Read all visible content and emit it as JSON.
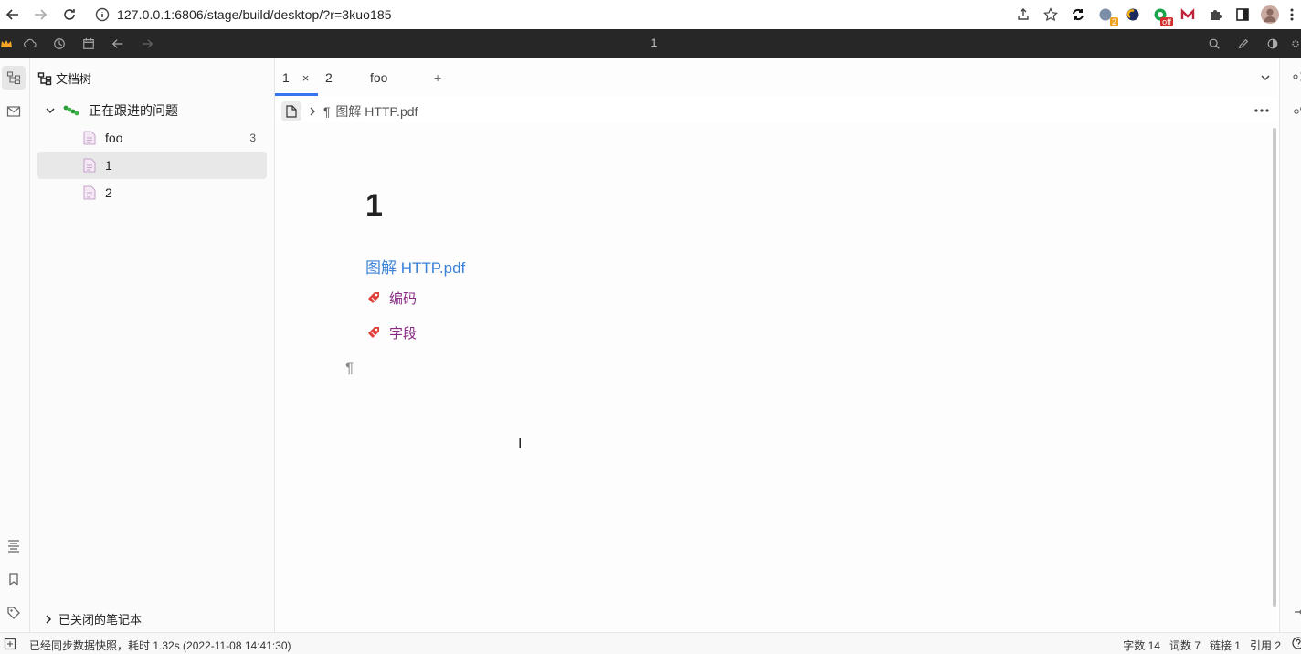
{
  "browser": {
    "url": "127.0.0.1:6806/stage/build/desktop/?r=3kuo185",
    "badges": {
      "ext1": "2",
      "ext2": "off"
    }
  },
  "app": {
    "title": "1"
  },
  "tree": {
    "header": "文档树",
    "notebook": "正在跟进的问题",
    "docs": [
      {
        "label": "foo",
        "count": "3"
      },
      {
        "label": "1",
        "count": ""
      },
      {
        "label": "2",
        "count": ""
      }
    ],
    "closed_label": "已关闭的笔记本"
  },
  "tabs": [
    {
      "label": "1",
      "close": "×"
    },
    {
      "label": "2"
    },
    {
      "label": "foo"
    }
  ],
  "tab_add": "+",
  "breadcrumb": {
    "marker": "¶",
    "label": "图解 HTTP.pdf"
  },
  "editor": {
    "title": "1",
    "link": "图解 HTTP.pdf",
    "tags": [
      "编码",
      "字段"
    ],
    "pilcrow": "¶"
  },
  "status": {
    "message": "已经同步数据快照，耗时 1.32s (2022-11-08 14:41:30)",
    "stats": [
      "字数 14",
      "词数 7",
      "链接 1",
      "引用 2"
    ]
  },
  "colors": {
    "accent": "#3575f0",
    "link": "#3b82d8",
    "tag": "#8a2a84",
    "toolbar": "#272727"
  }
}
